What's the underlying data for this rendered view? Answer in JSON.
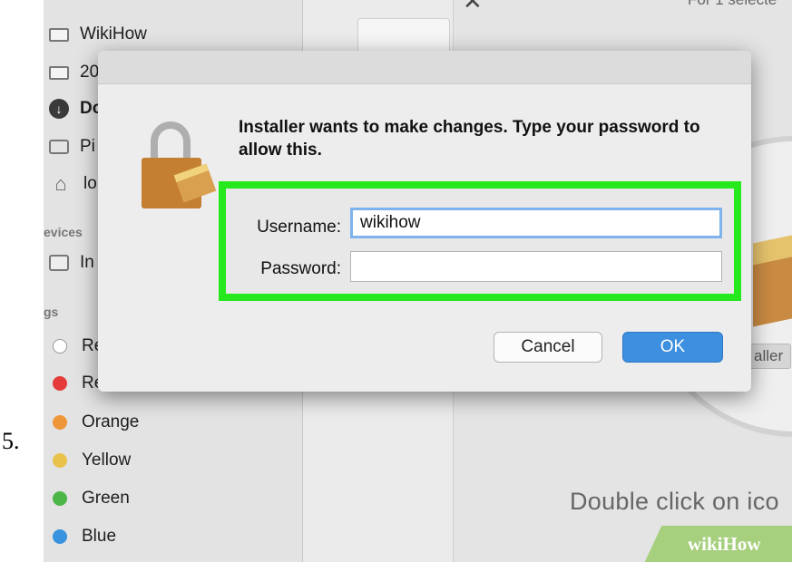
{
  "step_number": "5.",
  "sidebar": {
    "items": [
      {
        "label": "WikiHow",
        "icon": "folder-icon"
      },
      {
        "label": "20",
        "icon": "folder-icon"
      },
      {
        "label": "Do",
        "icon": "download-icon"
      },
      {
        "label": "Pi",
        "icon": "camera-icon"
      },
      {
        "label": "lo",
        "icon": "home-icon"
      }
    ],
    "devices_header": "evices",
    "devices": [
      {
        "label": "In",
        "icon": "disk-icon"
      }
    ],
    "tags_header": "gs",
    "tags": [
      {
        "label": "Re",
        "color": "#ffffff"
      },
      {
        "label": "Re",
        "color": "#e53b3b"
      },
      {
        "label": "Orange",
        "color": "#f0963a"
      },
      {
        "label": "Yellow",
        "color": "#e8c24a"
      },
      {
        "label": "Green",
        "color": "#4cb748"
      },
      {
        "label": "Blue",
        "color": "#3a93de"
      }
    ]
  },
  "right_pane": {
    "top_label": "For 1 selecte",
    "installer_badge": "aller",
    "hint": "Double click on ico",
    "watermark": "wikiHow"
  },
  "dialog": {
    "prompt": "Installer wants to make changes. Type your password to allow this.",
    "username_label": "Username:",
    "username_value": "wikihow",
    "password_label": "Password:",
    "password_value": "",
    "cancel_label": "Cancel",
    "ok_label": "OK"
  },
  "colors": {
    "highlight": "#25e81d",
    "ok_button": "#3d8fe0",
    "focus_ring": "#7eb3ee"
  }
}
